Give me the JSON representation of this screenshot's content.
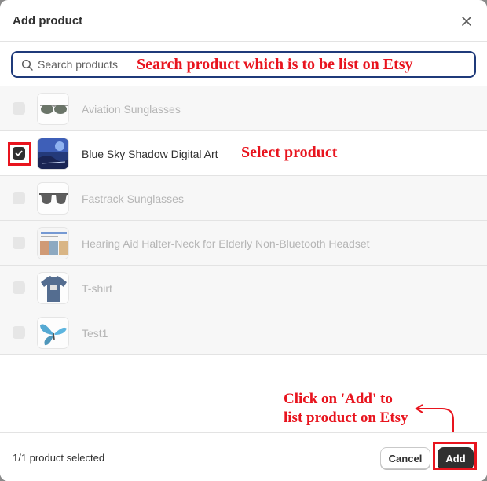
{
  "modal": {
    "title": "Add product"
  },
  "search": {
    "placeholder": "Search products",
    "value": ""
  },
  "products": [
    {
      "name": "Aviation Sunglasses",
      "selected": false,
      "thumb_icon": "sunglasses-icon"
    },
    {
      "name": "Blue Sky Shadow Digital Art",
      "selected": true,
      "thumb_icon": "digital-art-icon"
    },
    {
      "name": "Fastrack Sunglasses",
      "selected": false,
      "thumb_icon": "sunglasses-icon"
    },
    {
      "name": "Hearing Aid Halter-Neck for Elderly Non-Bluetooth Headset",
      "selected": false,
      "thumb_icon": "collage-icon"
    },
    {
      "name": "T-shirt",
      "selected": false,
      "thumb_icon": "tshirt-icon"
    },
    {
      "name": "Test1",
      "selected": false,
      "thumb_icon": "butterfly-icon"
    }
  ],
  "footer": {
    "selection_status": "1/1 product selected",
    "cancel_label": "Cancel",
    "add_label": "Add"
  },
  "annotations": {
    "search_hint": "Search product which is to be list on Etsy",
    "select_hint": "Select product",
    "add_hint_line1": "Click on 'Add' to",
    "add_hint_line2": "list product on Etsy"
  },
  "colors": {
    "annotation_red": "#e8141e",
    "primary_button": "#303030",
    "search_focus": "#1f3a7a"
  }
}
